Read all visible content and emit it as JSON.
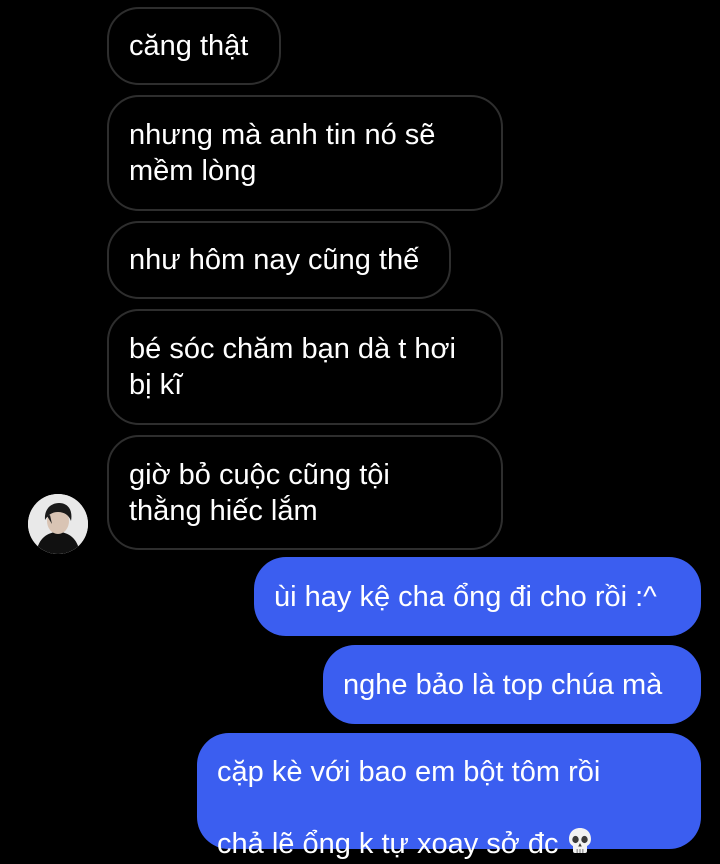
{
  "conversation": {
    "incoming": [
      {
        "text": "căng thật"
      },
      {
        "text": "nhưng mà anh tin nó sẽ\nmềm lòng"
      },
      {
        "text": "như hôm nay cũng thế"
      },
      {
        "text": "bé sóc chăm bạn dà t hơi\nbị kĩ"
      },
      {
        "text": "giờ bỏ cuộc cũng tội\nthằng hiếc lắm"
      }
    ],
    "outgoing": [
      {
        "text": "ùi hay kệ cha ổng đi cho rồi :^"
      },
      {
        "text": "nghe bảo là top chúa mà"
      },
      {
        "text_line1": "cặp kè với bao em bột tôm rồi",
        "text_line2": "chả lẽ ổng k tự xoay sở đc",
        "emoji": "skull-icon"
      }
    ]
  },
  "colors": {
    "background": "#000000",
    "incoming_border": "#2e2e2e",
    "outgoing_bubble": "#3b5ef0",
    "text": "#ffffff"
  }
}
